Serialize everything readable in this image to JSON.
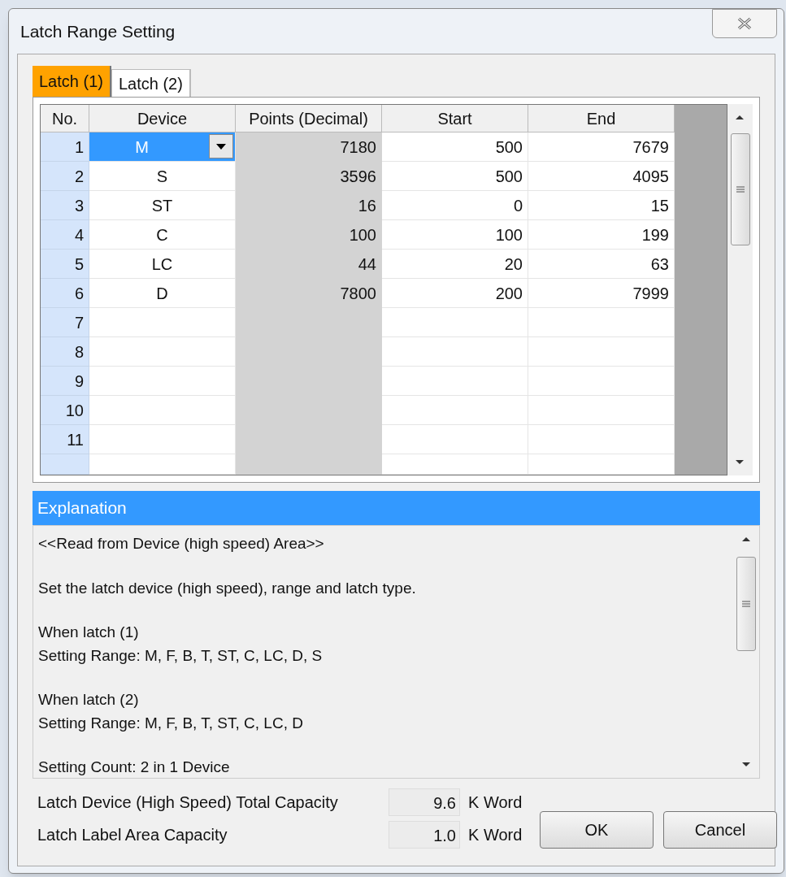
{
  "window": {
    "title": "Latch Range Setting"
  },
  "tabs": [
    {
      "label": "Latch (1)",
      "selected": true
    },
    {
      "label": "Latch (2)",
      "selected": false
    }
  ],
  "table": {
    "columns": [
      "No.",
      "Device",
      "Points (Decimal)",
      "Start",
      "End"
    ],
    "rows": [
      {
        "no": "1",
        "device": "M",
        "points": "7180",
        "start": "500",
        "end": "7679",
        "selected": true
      },
      {
        "no": "2",
        "device": "S",
        "points": "3596",
        "start": "500",
        "end": "4095",
        "selected": false
      },
      {
        "no": "3",
        "device": "ST",
        "points": "16",
        "start": "0",
        "end": "15",
        "selected": false
      },
      {
        "no": "4",
        "device": "C",
        "points": "100",
        "start": "100",
        "end": "199",
        "selected": false
      },
      {
        "no": "5",
        "device": "LC",
        "points": "44",
        "start": "20",
        "end": "63",
        "selected": false
      },
      {
        "no": "6",
        "device": "D",
        "points": "7800",
        "start": "200",
        "end": "7999",
        "selected": false
      },
      {
        "no": "7",
        "selected": false
      },
      {
        "no": "8",
        "selected": false
      },
      {
        "no": "9",
        "selected": false
      },
      {
        "no": "10",
        "selected": false
      },
      {
        "no": "11",
        "selected": false
      },
      {
        "selected": false
      }
    ]
  },
  "explanation": {
    "title": "Explanation",
    "paragraphs": [
      [
        "<<Read from Device (high speed) Area>>"
      ],
      [
        "Set the latch device (high speed), range and latch type."
      ],
      [
        "When latch (1)",
        "Setting Range: M, F, B, T, ST, C, LC, D, S"
      ],
      [
        "When latch (2)",
        "Setting Range: M, F, B, T, ST, C, LC, D"
      ],
      [
        "Setting Count: 2 in 1 Device"
      ]
    ]
  },
  "capacities": [
    {
      "label": "Latch Device (High Speed) Total Capacity",
      "value": "9.6",
      "unit": "K Word"
    },
    {
      "label": "Latch Label Area Capacity",
      "value": "1.0",
      "unit": "K Word"
    }
  ],
  "buttons": [
    "OK",
    "Cancel"
  ]
}
